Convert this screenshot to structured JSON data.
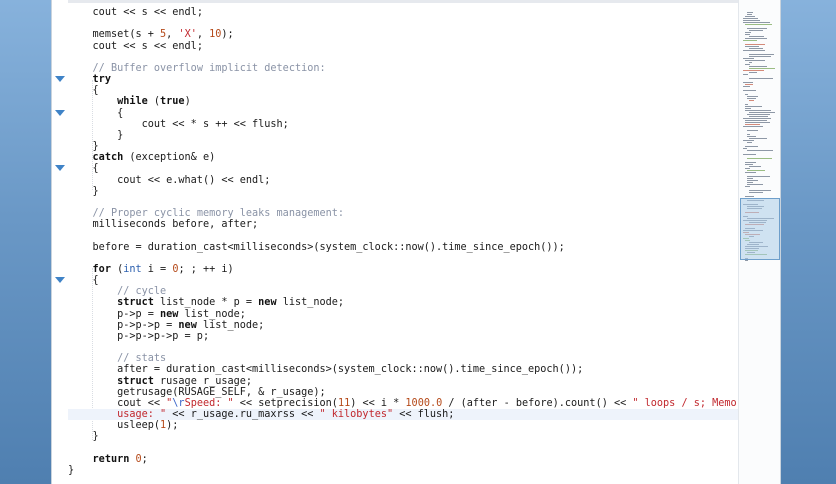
{
  "editor": {
    "lines": [
      {
        "indent": "    ",
        "parts": [
          {
            "t": "cout << s << endl;"
          }
        ]
      },
      {
        "indent": "",
        "parts": []
      },
      {
        "indent": "    ",
        "parts": [
          {
            "t": "memset(s + "
          },
          {
            "t": "5",
            "c": "num"
          },
          {
            "t": ", "
          },
          {
            "t": "'X'",
            "c": "str"
          },
          {
            "t": ", "
          },
          {
            "t": "10",
            "c": "num"
          },
          {
            "t": ");"
          }
        ]
      },
      {
        "indent": "    ",
        "parts": [
          {
            "t": "cout << s << endl;"
          }
        ]
      },
      {
        "indent": "",
        "parts": []
      },
      {
        "indent": "    ",
        "parts": [
          {
            "t": "// Buffer overflow implicit detection:",
            "c": "cmt"
          }
        ]
      },
      {
        "indent": "    ",
        "fold": true,
        "parts": [
          {
            "t": "try",
            "c": "kw"
          }
        ]
      },
      {
        "indent": "    ",
        "parts": [
          {
            "t": "{"
          }
        ]
      },
      {
        "indent": "        ",
        "parts": [
          {
            "t": "while",
            "c": "kw"
          },
          {
            "t": " ("
          },
          {
            "t": "true",
            "c": "kw"
          },
          {
            "t": ")"
          }
        ]
      },
      {
        "indent": "        ",
        "fold": true,
        "parts": [
          {
            "t": "{"
          }
        ]
      },
      {
        "indent": "            ",
        "parts": [
          {
            "t": "cout << * s ++ << flush;"
          }
        ]
      },
      {
        "indent": "        ",
        "parts": [
          {
            "t": "}"
          }
        ]
      },
      {
        "indent": "    ",
        "parts": [
          {
            "t": "}"
          }
        ]
      },
      {
        "indent": "    ",
        "parts": [
          {
            "t": "catch",
            "c": "kw"
          },
          {
            "t": " (exception& e)"
          }
        ]
      },
      {
        "indent": "    ",
        "fold": true,
        "parts": [
          {
            "t": "{"
          }
        ]
      },
      {
        "indent": "        ",
        "parts": [
          {
            "t": "cout << e.what() << endl;"
          }
        ]
      },
      {
        "indent": "    ",
        "parts": [
          {
            "t": "}"
          }
        ]
      },
      {
        "indent": "",
        "parts": []
      },
      {
        "indent": "    ",
        "parts": [
          {
            "t": "// Proper cyclic memory leaks management:",
            "c": "cmt"
          }
        ]
      },
      {
        "indent": "    ",
        "parts": [
          {
            "t": "milliseconds before, after;"
          }
        ]
      },
      {
        "indent": "",
        "parts": []
      },
      {
        "indent": "    ",
        "parts": [
          {
            "t": "before = duration_cast<milliseconds>(system_clock::now().time_since_epoch());"
          }
        ]
      },
      {
        "indent": "",
        "parts": []
      },
      {
        "indent": "    ",
        "parts": [
          {
            "t": "for",
            "c": "kw"
          },
          {
            "t": " ("
          },
          {
            "t": "int",
            "c": "type"
          },
          {
            "t": " i = "
          },
          {
            "t": "0",
            "c": "num"
          },
          {
            "t": "; ; ++ i)"
          }
        ]
      },
      {
        "indent": "    ",
        "fold": true,
        "parts": [
          {
            "t": "{"
          }
        ]
      },
      {
        "indent": "        ",
        "parts": [
          {
            "t": "// cycle",
            "c": "cmt"
          }
        ]
      },
      {
        "indent": "        ",
        "parts": [
          {
            "t": "struct",
            "c": "kw"
          },
          {
            "t": " list_node * p = "
          },
          {
            "t": "new",
            "c": "kw"
          },
          {
            "t": " list_node;"
          }
        ]
      },
      {
        "indent": "        ",
        "parts": [
          {
            "t": "p->p = "
          },
          {
            "t": "new",
            "c": "kw"
          },
          {
            "t": " list_node;"
          }
        ]
      },
      {
        "indent": "        ",
        "parts": [
          {
            "t": "p->p->p = "
          },
          {
            "t": "new",
            "c": "kw"
          },
          {
            "t": " list_node;"
          }
        ]
      },
      {
        "indent": "        ",
        "parts": [
          {
            "t": "p->p->p->p = p;"
          }
        ]
      },
      {
        "indent": "",
        "parts": []
      },
      {
        "indent": "        ",
        "parts": [
          {
            "t": "// stats",
            "c": "cmt"
          }
        ]
      },
      {
        "indent": "        ",
        "parts": [
          {
            "t": "after = duration_cast<milliseconds>(system_clock::now().time_since_epoch());"
          }
        ]
      },
      {
        "indent": "        ",
        "parts": [
          {
            "t": "struct",
            "c": "kw"
          },
          {
            "t": " rusage r_usage;"
          }
        ]
      },
      {
        "indent": "        ",
        "parts": [
          {
            "t": "getrusage(RUSAGE_SELF, & r_usage);"
          }
        ]
      },
      {
        "indent": "        ",
        "parts": [
          {
            "t": "cout << "
          },
          {
            "t": "\"",
            "c": "str"
          },
          {
            "t": "\\r",
            "c": "esc"
          },
          {
            "t": "Speed: \"",
            "c": "str"
          },
          {
            "t": " << setprecision("
          },
          {
            "t": "11",
            "c": "num"
          },
          {
            "t": ") << i * "
          },
          {
            "t": "1000.0",
            "c": "num"
          },
          {
            "t": " / (after - before).count() << "
          },
          {
            "t": "\" loops / s; Memory",
            "c": "str"
          }
        ]
      },
      {
        "indent": "        ",
        "current": true,
        "parts": [
          {
            "t": "usage: \"",
            "c": "str"
          },
          {
            "t": " << r_usage.ru_maxrss << "
          },
          {
            "t": "\" kilobytes\"",
            "c": "str"
          },
          {
            "t": " << flush;"
          }
        ]
      },
      {
        "indent": "        ",
        "parts": [
          {
            "t": "usleep("
          },
          {
            "t": "1",
            "c": "num"
          },
          {
            "t": ");"
          }
        ]
      },
      {
        "indent": "    ",
        "parts": [
          {
            "t": "}"
          }
        ]
      },
      {
        "indent": "",
        "parts": []
      },
      {
        "indent": "    ",
        "parts": [
          {
            "t": "return",
            "c": "kw"
          },
          {
            "t": " "
          },
          {
            "t": "0",
            "c": "num"
          },
          {
            "t": ";"
          }
        ]
      },
      {
        "indent": "",
        "parts": [
          {
            "t": "}"
          }
        ]
      }
    ]
  },
  "colors": {
    "keyword": "#111111",
    "type": "#2b5fae",
    "comment": "#8a93a6",
    "string": "#c1272d",
    "number": "#b54a1a",
    "escape": "#3a65c8",
    "fold_marker": "#3f83c7",
    "minimap_viewport": "#6e9fcb"
  },
  "icons": {
    "fold": "fold-arrow-icon"
  }
}
